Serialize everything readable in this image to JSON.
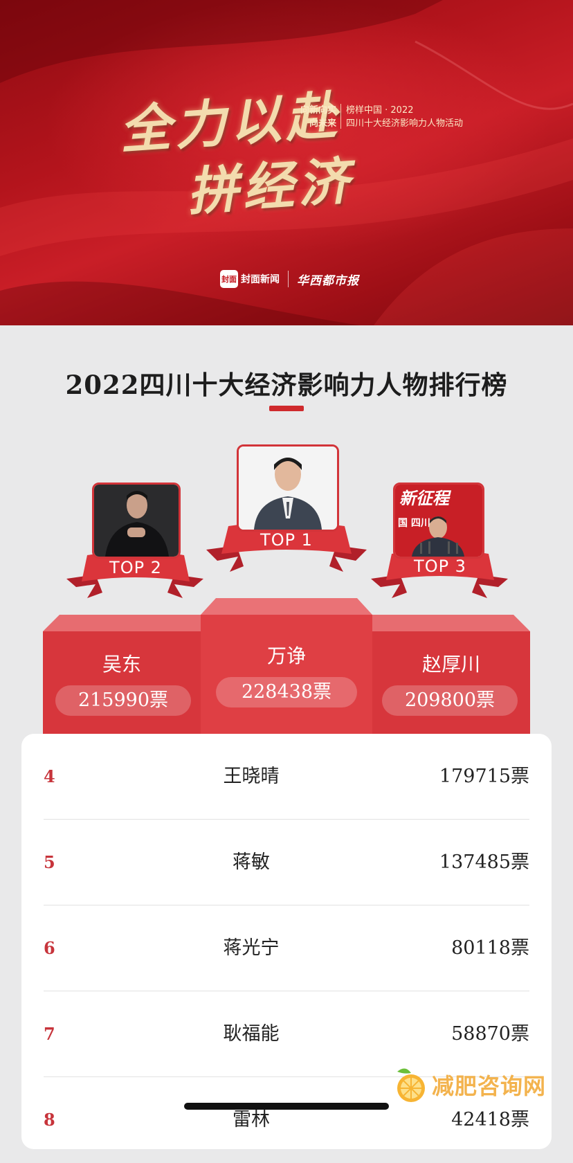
{
  "banner": {
    "headline_line1": "全力以赴",
    "headline_line2": "拼经济",
    "slogan_line1": "向新向实",
    "slogan_line2": "向未来",
    "event_line1": "榜样中国 · 2022",
    "event_line2": "四川十大经济影响力人物活动",
    "logo_mark": "封面",
    "logo_name": "封面新闻",
    "logo_partner": "华西都市报"
  },
  "title": "2022四川十大经济影响力人物排行榜",
  "podium": [
    {
      "rank_label": "TOP 2",
      "name": "吴东",
      "votes": "215990票"
    },
    {
      "rank_label": "TOP 1",
      "name": "万诤",
      "votes": "228438票"
    },
    {
      "rank_label": "TOP 3",
      "name": "赵厚川",
      "votes": "209800票"
    }
  ],
  "photo3_backdrop": "新征程",
  "photo3_backdrop2": "国 四川省",
  "list": [
    {
      "rank": "4",
      "name": "王晓晴",
      "votes": "179715票"
    },
    {
      "rank": "5",
      "name": "蒋敏",
      "votes": "137485票"
    },
    {
      "rank": "6",
      "name": "蒋光宁",
      "votes": "80118票"
    },
    {
      "rank": "7",
      "name": "耿福能",
      "votes": "58870票"
    },
    {
      "rank": "8",
      "name": "雷林",
      "votes": "42418票"
    }
  ],
  "watermark": "减肥咨询网",
  "colors": {
    "accent": "#cf2a2d",
    "banner": "#b3141c",
    "podium": "#d8383e"
  }
}
